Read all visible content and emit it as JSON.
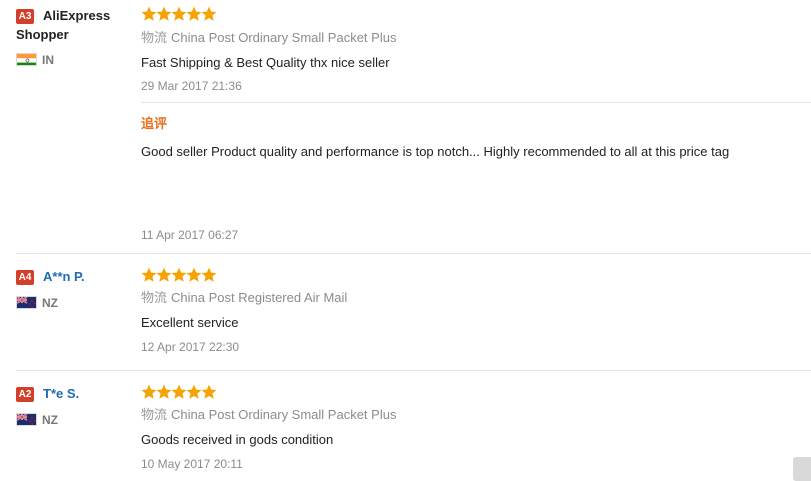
{
  "colors": {
    "star": "#f5a300",
    "badge": "#d23f2a",
    "name_link": "#1f6bb5",
    "additional": "#e5711c"
  },
  "reviews": [
    {
      "rank": "A3",
      "name": "AliExpress",
      "name_line2": "Shopper",
      "country": "IN",
      "flag": "india-flag-icon",
      "rating": 5,
      "logistics_label": "物流",
      "logistics": "China Post Ordinary Small Packet Plus",
      "feedback": "Fast Shipping & Best Quality thx nice seller",
      "date": "29 Mar 2017 21:36",
      "additional_label": "追评",
      "additional_feedback": "Good seller Product quality and performance is top notch... Highly recommended to all at this price tag",
      "additional_date": "11 Apr 2017 06:27"
    },
    {
      "rank": "A4",
      "name": "A**n P.",
      "country": "NZ",
      "flag": "new-zealand-flag-icon",
      "rating": 5,
      "logistics_label": "物流",
      "logistics": "China Post Registered Air Mail",
      "feedback": "Excellent service",
      "date": "12 Apr 2017 22:30"
    },
    {
      "rank": "A2",
      "name": "T*e S.",
      "country": "NZ",
      "flag": "new-zealand-flag-icon",
      "rating": 5,
      "logistics_label": "物流",
      "logistics": "China Post Ordinary Small Packet Plus",
      "feedback": "Goods received in gods condition",
      "date": "10 May 2017 20:11"
    }
  ]
}
